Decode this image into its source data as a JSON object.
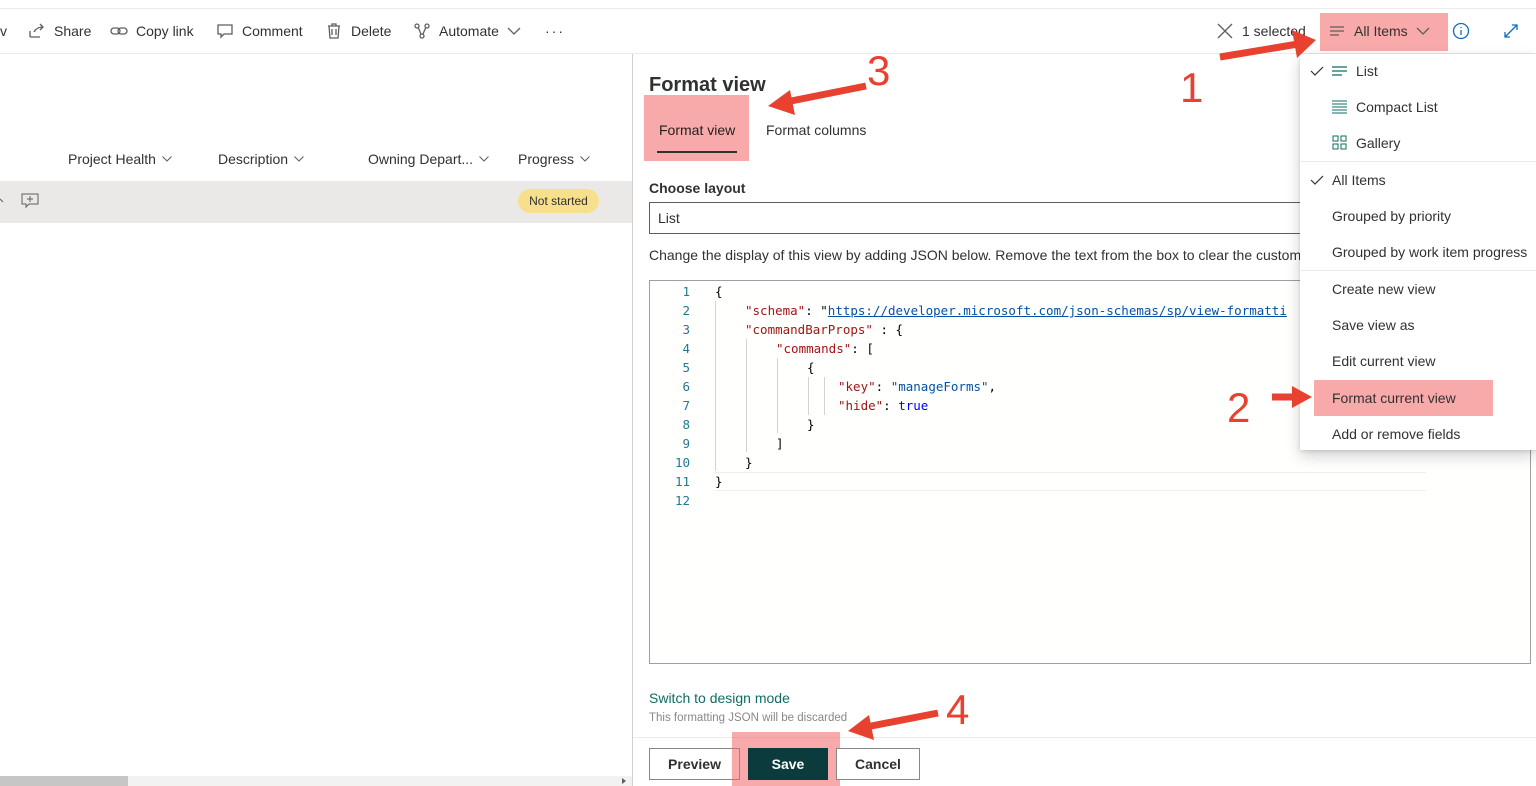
{
  "commandbar": {
    "partial_label": "v",
    "share": "Share",
    "copy_link": "Copy link",
    "comment": "Comment",
    "delete": "Delete",
    "automate": "Automate",
    "more": "···",
    "selected": "1 selected",
    "view_name": "All Items"
  },
  "list": {
    "columns": [
      "Project Health",
      "Description",
      "Owning Depart...",
      "Progress"
    ],
    "row_status": "Not started"
  },
  "panel": {
    "title": "Format view",
    "tabs": [
      "Format view",
      "Format columns"
    ],
    "layout_label": "Choose layout",
    "layout_value": "List",
    "help": "Change the display of this view by adding JSON below. Remove the text from the box to clear the custom",
    "line_numbers": [
      "1",
      "2",
      "3",
      "4",
      "5",
      "6",
      "7",
      "8",
      "9",
      "10",
      "11",
      "12"
    ],
    "code": {
      "l1": "{",
      "schema_key": "\"schema\"",
      "schema_url": "https://developer.microsoft.com/json-schemas/sp/view-formatti",
      "cmdbar_key": "\"commandBarProps\"",
      "cmdbar_rest": " : {",
      "commands_key": "\"commands\"",
      "commands_rest": ": [",
      "l5": "{",
      "key_key": "\"key\"",
      "key_val": "\"manageForms\"",
      "hide_key": "\"hide\"",
      "hide_val": "true",
      "l8": "}",
      "l9": "]",
      "l10": "}",
      "l11": "}"
    },
    "design_link": "Switch to design mode",
    "discard_note": "This formatting JSON will be discarded",
    "preview": "Preview",
    "save": "Save",
    "cancel": "Cancel"
  },
  "menu": {
    "layouts": [
      "List",
      "Compact List",
      "Gallery"
    ],
    "views": [
      "All Items",
      "Grouped by priority",
      "Grouped by work item progress"
    ],
    "actions": [
      "Create new view",
      "Save view as",
      "Edit current view",
      "Format current view",
      "Add or remove fields"
    ]
  },
  "annotations": [
    "1",
    "2",
    "3",
    "4"
  ],
  "colors": {
    "highlight": "#f36464",
    "annotation": "#e8412f",
    "primary": "#0b3b3d",
    "link": "#0f6c64",
    "badge": "#f7e08b"
  }
}
